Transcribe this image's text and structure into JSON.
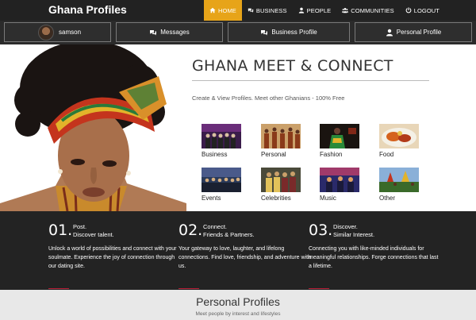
{
  "brand": "Ghana Profiles",
  "nav": [
    {
      "label": "HOME",
      "icon": "home-icon",
      "active": true
    },
    {
      "label": "BUSINESS",
      "icon": "chat-icon",
      "active": false
    },
    {
      "label": "PEOPLE",
      "icon": "user-icon",
      "active": false
    },
    {
      "label": "COMMUNITIES",
      "icon": "users-icon",
      "active": false
    },
    {
      "label": "LOGOUT",
      "icon": "logout-icon",
      "active": false
    }
  ],
  "subnav": {
    "user": "samson",
    "messages": "Messages",
    "business_profile": "Business Profile",
    "personal_profile": "Personal Profile"
  },
  "hero": {
    "title": "GHANA MEET & CONNECT",
    "subtitle": "Create & View Profiles. Meet other Ghanians - 100% Free"
  },
  "categories": [
    {
      "label": "Business"
    },
    {
      "label": "Personal"
    },
    {
      "label": "Fashion"
    },
    {
      "label": "Food"
    },
    {
      "label": "Events"
    },
    {
      "label": "Celebrities"
    },
    {
      "label": "Music"
    },
    {
      "label": "Other"
    }
  ],
  "features": [
    {
      "num": "01.",
      "h1": "Post.",
      "h2": "Discover talent.",
      "desc": "Unlock a world of possibilities and connect with your soulmate. Experience the joy of connection through our dating site."
    },
    {
      "num": "02.",
      "h1": "Connect.",
      "h2": "Friends & Partners.",
      "desc": "Your gateway to love, laughter, and lifelong connections. Find love, friendship, and adventure with us."
    },
    {
      "num": "03.",
      "h1": "Discover.",
      "h2": "Similar Interest.",
      "desc": "Connecting you with like-minded individuals for meaningful relationships. Forge connections that last a lifetime."
    }
  ],
  "profiles": {
    "title": "Personal Profiles",
    "subtitle": "Meet people by interest and lifestyles"
  },
  "colors": {
    "accent": "#e7a419",
    "dark": "#232323",
    "underline": "#c0223b"
  }
}
